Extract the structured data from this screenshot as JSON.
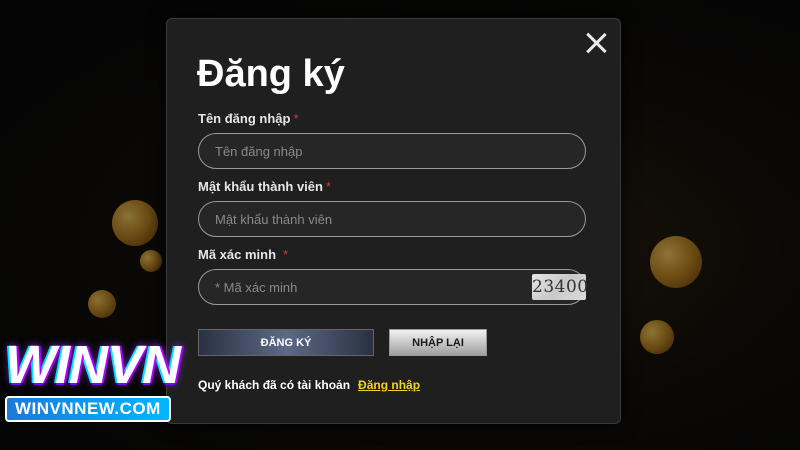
{
  "modal": {
    "title": "Đăng ký",
    "fields": [
      {
        "label": "Tên đăng nhập",
        "required_mark": "*",
        "placeholder": "Tên đăng nhập"
      },
      {
        "label": "Mật khẩu thành viên",
        "required_mark": "*",
        "placeholder": "Mật khẩu thành viên"
      },
      {
        "label": "Mã xác minh",
        "required_mark": "*",
        "placeholder": "* Mã xác minh"
      }
    ],
    "captcha_code": "23400",
    "register_button": "ĐĂNG KÝ",
    "reset_button": "NHẬP LẠI",
    "account_prompt": "Quý khách đã có tài khoản",
    "login_link": "Đăng nhập",
    "close_icon": "close-icon"
  },
  "brand": {
    "logo": "WINVN",
    "url": "WINVNNEW.COM"
  },
  "colors": {
    "modal_bg": "#1f1f20",
    "required": "#d23a3a",
    "link": "#f2d325",
    "brand_url_bg": "#1a7ad8"
  }
}
